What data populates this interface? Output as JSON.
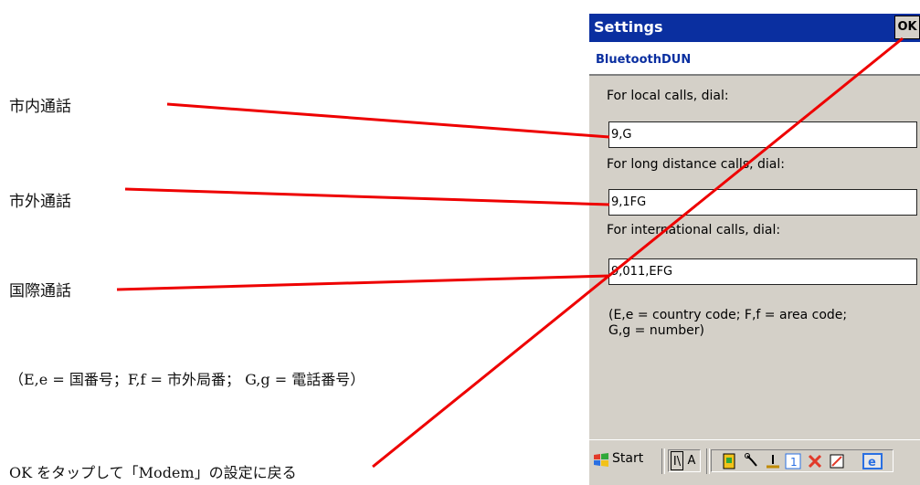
{
  "annotations": {
    "local": "市内通話",
    "long": "市外通話",
    "intl": "国際通話",
    "codes": "（E,e =  国番号；F,f =  市外局番；  G,g =  電話番号）",
    "ok_hint": "OK をタップして「Modem」の設定に戻る"
  },
  "window": {
    "title": "Settings",
    "ok_label": "OK",
    "subtitle": "BluetoothDUN"
  },
  "fields": {
    "local_label": "For local calls, dial:",
    "local_value": "9,G",
    "long_label": "For long distance calls, dial:",
    "long_value": "9,1FG",
    "intl_label": "For international calls, dial:",
    "intl_value": "9,011,EFG"
  },
  "help": {
    "line1": "(E,e = country code; F,f = area code;",
    "line2": "G,g = number)"
  },
  "taskbar": {
    "start_label": "Start",
    "ime_1": "I\\",
    "ime_2": "A",
    "icons": [
      "sim-icon",
      "wrench-icon",
      "connection-icon",
      "number-one-icon",
      "bluetooth-icon",
      "pen-icon",
      "ie-icon"
    ]
  },
  "colors": {
    "title_bar": "#0a2fa0",
    "subtitle": "#0a2fa0",
    "content_bg": "#d4d0c8",
    "callout_line": "#ee0000"
  }
}
